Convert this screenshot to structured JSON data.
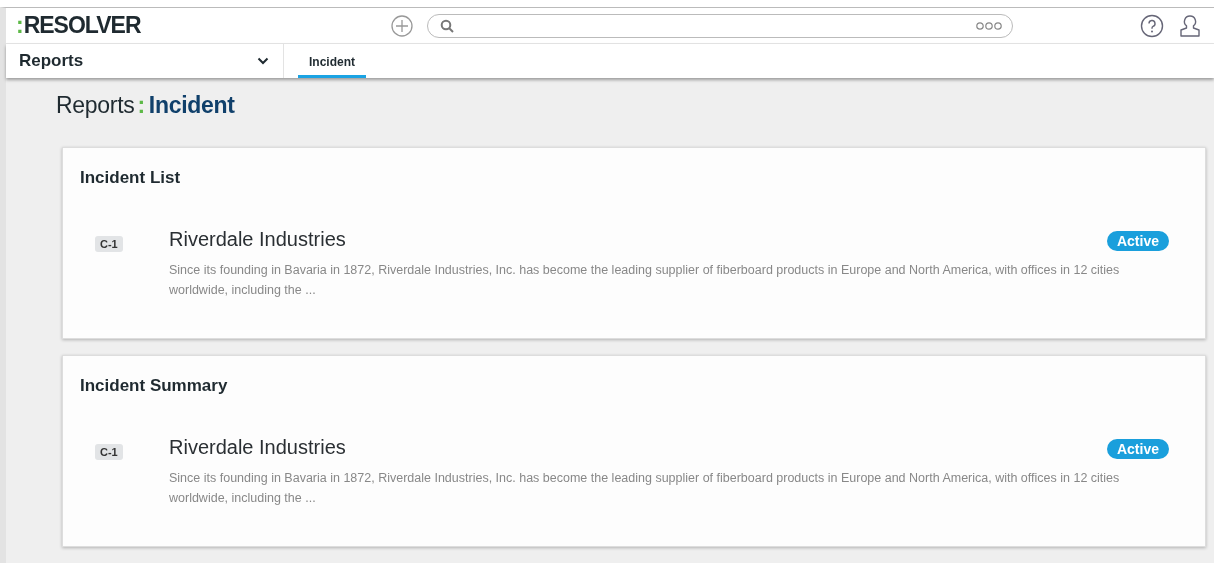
{
  "logo": {
    "mark": ":",
    "name": "RESOLVER"
  },
  "nav": {
    "dropdown": "Reports",
    "tabs": [
      {
        "label": "Incident",
        "selected": true
      }
    ]
  },
  "breadcrumb": {
    "parent": "Reports",
    "separator": ":",
    "current": "Incident"
  },
  "sections": [
    {
      "title": "Incident List",
      "items": [
        {
          "code": "C-1",
          "name": "Riverdale Industries",
          "status": "Active",
          "description": "Since its founding in Bavaria in 1872, Riverdale Industries, Inc. has become the leading supplier of fiberboard products in Europe and North America, with offices in 12 cities worldwide, including the ..."
        }
      ]
    },
    {
      "title": "Incident Summary",
      "items": [
        {
          "code": "C-1",
          "name": "Riverdale Industries",
          "status": "Active",
          "description": "Since its founding in Bavaria in 1872, Riverdale Industries, Inc. has become the leading supplier of fiberboard products in Europe and North America, with offices in 12 cities worldwide, including the ..."
        }
      ]
    }
  ]
}
